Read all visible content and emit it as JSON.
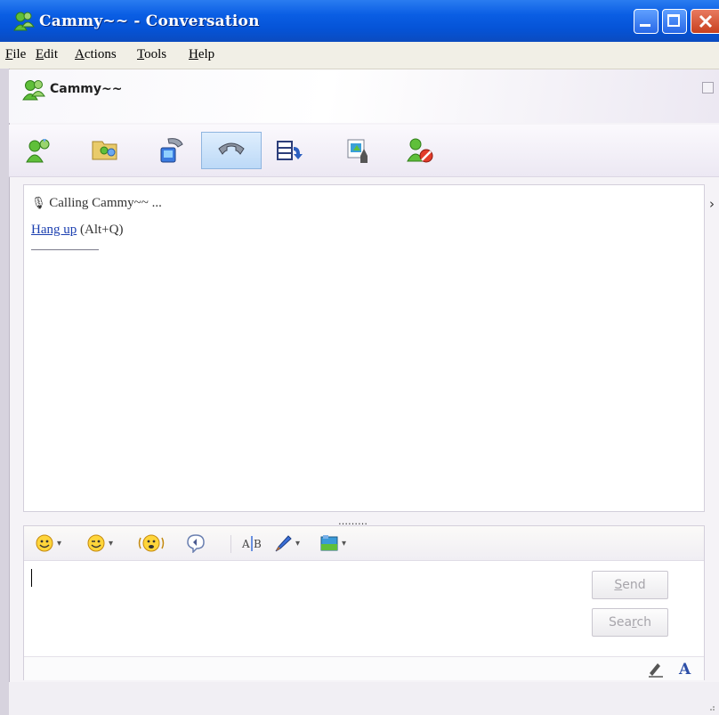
{
  "window": {
    "title": "Cammy~~ - Conversation",
    "icon": "contact-icon",
    "accent_color": "#0553d6"
  },
  "menu": {
    "items": [
      {
        "label": "File",
        "underline": "F",
        "rest": "ile"
      },
      {
        "label": "Edit",
        "underline": "E",
        "rest": "dit"
      },
      {
        "label": "Actions",
        "underline": "A",
        "rest": "ctions"
      },
      {
        "label": "Tools",
        "underline": "T",
        "rest": "ools"
      },
      {
        "label": "Help",
        "underline": "H",
        "rest": "elp"
      }
    ]
  },
  "contact": {
    "name": "Cammy~~"
  },
  "toolbar": {
    "tools": [
      {
        "name": "invite-icon"
      },
      {
        "name": "share-files-icon"
      },
      {
        "name": "video-call-icon"
      },
      {
        "name": "call-icon",
        "active": true
      },
      {
        "name": "activities-icon"
      },
      {
        "name": "games-icon"
      },
      {
        "name": "block-icon"
      }
    ]
  },
  "conversation": {
    "status": "Calling Cammy~~ ...",
    "hangup_link": "Hang up",
    "hangup_shortcut": "(Alt+Q)",
    "side_arrow": "›",
    "splitter": "………"
  },
  "compose": {
    "send_label": "Send",
    "send_underline": "S",
    "send_rest": "end",
    "search_label": "Search",
    "search_pre": "Sea",
    "search_underline": "r",
    "search_rest": "ch",
    "format_tools": [
      "emoticon-icon",
      "wink-icon",
      "nudge-icon",
      "voice-clip-icon",
      "font-icon",
      "background-icon",
      "wallpaper-icon"
    ]
  }
}
